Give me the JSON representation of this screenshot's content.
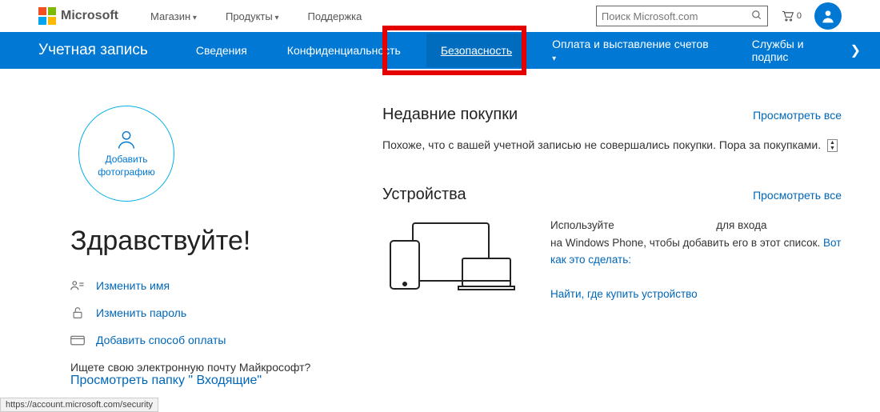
{
  "header": {
    "brand": "Microsoft",
    "nav": [
      "Магазин",
      "Продукты",
      "Поддержка"
    ],
    "search_placeholder": "Поиск Microsoft.com",
    "cart_count": "0"
  },
  "bluebar": {
    "title": "Учетная запись",
    "items": [
      {
        "label": "Сведения"
      },
      {
        "label": "Конфиденциальность"
      },
      {
        "label": "Безопасность",
        "active": true
      },
      {
        "label": "Оплата и выставление счетов",
        "dropdown": true
      },
      {
        "label": "Службы и подпис"
      }
    ]
  },
  "profile": {
    "add_photo_line1": "Добавить",
    "add_photo_line2": "фотографию",
    "greeting": "Здравствуйте!",
    "actions": [
      {
        "icon": "person-edit-icon",
        "label": "Изменить имя"
      },
      {
        "icon": "lock-icon",
        "label": "Изменить пароль"
      },
      {
        "icon": "card-icon",
        "label": "Добавить способ оплаты"
      }
    ],
    "email_prompt": "Ищете свою электронную почту Майкрософт?",
    "email_link": "Просмотреть папку \" Входящие\""
  },
  "purchases": {
    "title": "Недавние покупки",
    "view_all": "Просмотреть все",
    "body": "Похоже, что с вашей учетной записью не совершались покупки. Пора за покупками."
  },
  "devices": {
    "title": "Устройства",
    "view_all": "Просмотреть все",
    "text1a": "Используйте",
    "text1b": "для входа",
    "text2": "на Windows Phone, чтобы добавить его в этот список.",
    "link1": "Вот как это сделать:",
    "link2": "Найти, где купить устройство"
  },
  "status_url": "https://account.microsoft.com/security"
}
